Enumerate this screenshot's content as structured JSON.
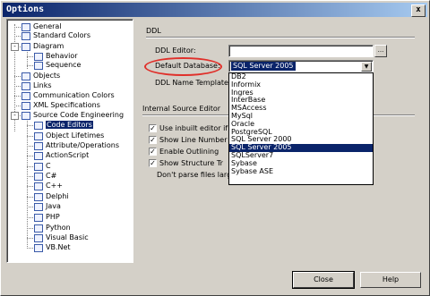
{
  "window": {
    "title": "Options",
    "close_glyph": "x"
  },
  "tree": {
    "items": [
      {
        "label": "General",
        "icon": "general-icon"
      },
      {
        "label": "Standard Colors",
        "icon": "colors-icon"
      },
      {
        "label": "Diagram",
        "icon": "diagram-icon",
        "expander": "-"
      },
      {
        "label": "Behavior",
        "icon": "behavior-icon"
      },
      {
        "label": "Sequence",
        "icon": "sequence-icon"
      },
      {
        "label": "Objects",
        "icon": "objects-icon"
      },
      {
        "label": "Links",
        "icon": "links-icon"
      },
      {
        "label": "Communication Colors",
        "icon": "communication-icon"
      },
      {
        "label": "XML Specifications",
        "icon": "xml-icon"
      },
      {
        "label": "Source Code Engineering",
        "icon": "source-code-icon",
        "expander": "-"
      },
      {
        "label": "Code Editors",
        "icon": "code-editors-icon",
        "selected": true
      },
      {
        "label": "Object Lifetimes",
        "icon": "lifetimes-icon"
      },
      {
        "label": "Attribute/Operations",
        "icon": "attribute-icon"
      },
      {
        "label": "ActionScript",
        "icon": "actionscript-icon"
      },
      {
        "label": "C",
        "icon": "c-icon"
      },
      {
        "label": "C#",
        "icon": "csharp-icon"
      },
      {
        "label": "C++",
        "icon": "cpp-icon"
      },
      {
        "label": "Delphi",
        "icon": "delphi-icon"
      },
      {
        "label": "Java",
        "icon": "java-icon"
      },
      {
        "label": "PHP",
        "icon": "php-icon"
      },
      {
        "label": "Python",
        "icon": "python-icon"
      },
      {
        "label": "Visual Basic",
        "icon": "vb-icon"
      },
      {
        "label": "VB.Net",
        "icon": "vbnet-icon"
      }
    ]
  },
  "ddl": {
    "header": "DDL",
    "ddl_editor_label": "DDL Editor:",
    "ddl_editor_value": "",
    "browse_label": "...",
    "default_db_label": "Default Database:",
    "default_db_value": "SQL Server 2005",
    "name_templates_label": "DDL Name Templates:"
  },
  "internal_editor": {
    "header": "Internal Source Editor",
    "options": [
      {
        "label": "Use inbuilt editor if",
        "checked": true
      },
      {
        "label": "Show Line Number",
        "checked": true
      },
      {
        "label": "Enable Outlining",
        "checked": true
      },
      {
        "label": "Show Structure Tr",
        "checked": true
      }
    ],
    "parse_label": "Don't parse files larger"
  },
  "dropdown": {
    "options": [
      "DB2",
      "Informix",
      "Ingres",
      "InterBase",
      "MSAccess",
      "MySql",
      "Oracle",
      "PostgreSQL",
      "SQL Server 2000",
      "SQL Server 2005",
      "SQLServer7",
      "Sybase",
      "Sybase ASE"
    ],
    "selected_index": 9
  },
  "buttons": {
    "close": "Close",
    "help": "Help"
  },
  "colors": {
    "selection": "#0a246a",
    "highlight_ring": "#e0302a"
  }
}
